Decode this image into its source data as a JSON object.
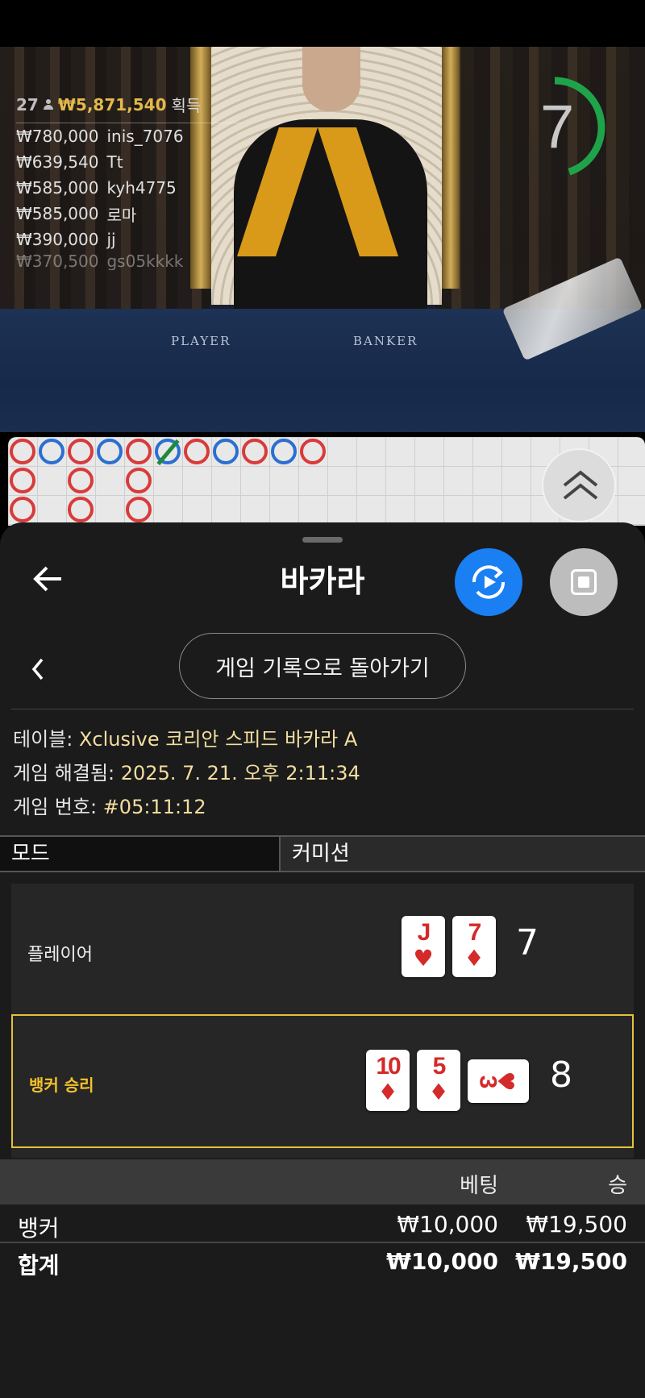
{
  "video": {
    "winners_header": {
      "count": "27",
      "total": "₩5,871,540",
      "label": "획득"
    },
    "winners": [
      {
        "amount": "₩780,000",
        "name": "inis_7076"
      },
      {
        "amount": "₩639,540",
        "name": "Tt"
      },
      {
        "amount": "₩585,000",
        "name": "kyh4775"
      },
      {
        "amount": "₩585,000",
        "name": "로마"
      },
      {
        "amount": "₩390,000",
        "name": "jj"
      },
      {
        "amount": "₩370,500",
        "name": "gs05kkkk"
      }
    ],
    "felt_player": "PLAYER",
    "felt_banker": "BANKER",
    "timer": {
      "value": "7",
      "fraction_remaining": 0.45,
      "color": "#1fa34a"
    }
  },
  "roadmap": {
    "colors": {
      "banker": "#d93a3a",
      "player": "#2a6fd1",
      "tie": "#1e8a3c"
    },
    "row1": [
      "B",
      "P",
      "B",
      "P",
      "B",
      "P-tie",
      "B",
      "P",
      "B",
      "P",
      "B"
    ],
    "row2": [
      "B",
      "",
      "B",
      "",
      "B"
    ],
    "row3": [
      "B",
      "",
      "B",
      "",
      "B"
    ]
  },
  "panel": {
    "title": "바카라",
    "history_button": "게임 기록으로 돌아가기",
    "info": {
      "table_label": "테이블:",
      "table_value": "Xclusive 코리안 스피드 바카라 A",
      "resolved_label": "게임 해결됨:",
      "resolved_value": "2025. 7. 21. 오후 2:11:34",
      "number_label": "게임 번호:",
      "number_value": "#05:11:12"
    },
    "mode_label": "모드",
    "mode_value": "커미션",
    "player": {
      "label": "플레이어",
      "cards": [
        {
          "rank": "J",
          "suit": "♥"
        },
        {
          "rank": "7",
          "suit": "♦"
        }
      ],
      "score": "7"
    },
    "banker": {
      "label": "뱅커 승리",
      "cards": [
        {
          "rank": "10",
          "suit": "♦"
        },
        {
          "rank": "5",
          "suit": "♦"
        }
      ],
      "side_card": {
        "rank": "3",
        "suit": "♥"
      },
      "score": "8"
    },
    "bets": {
      "col_bet": "베팅",
      "col_win": "승",
      "rows": [
        {
          "name": "뱅커",
          "bet": "₩10,000",
          "win": "₩19,500"
        },
        {
          "name": "합계",
          "bet": "₩10,000",
          "win": "₩19,500"
        }
      ]
    }
  }
}
